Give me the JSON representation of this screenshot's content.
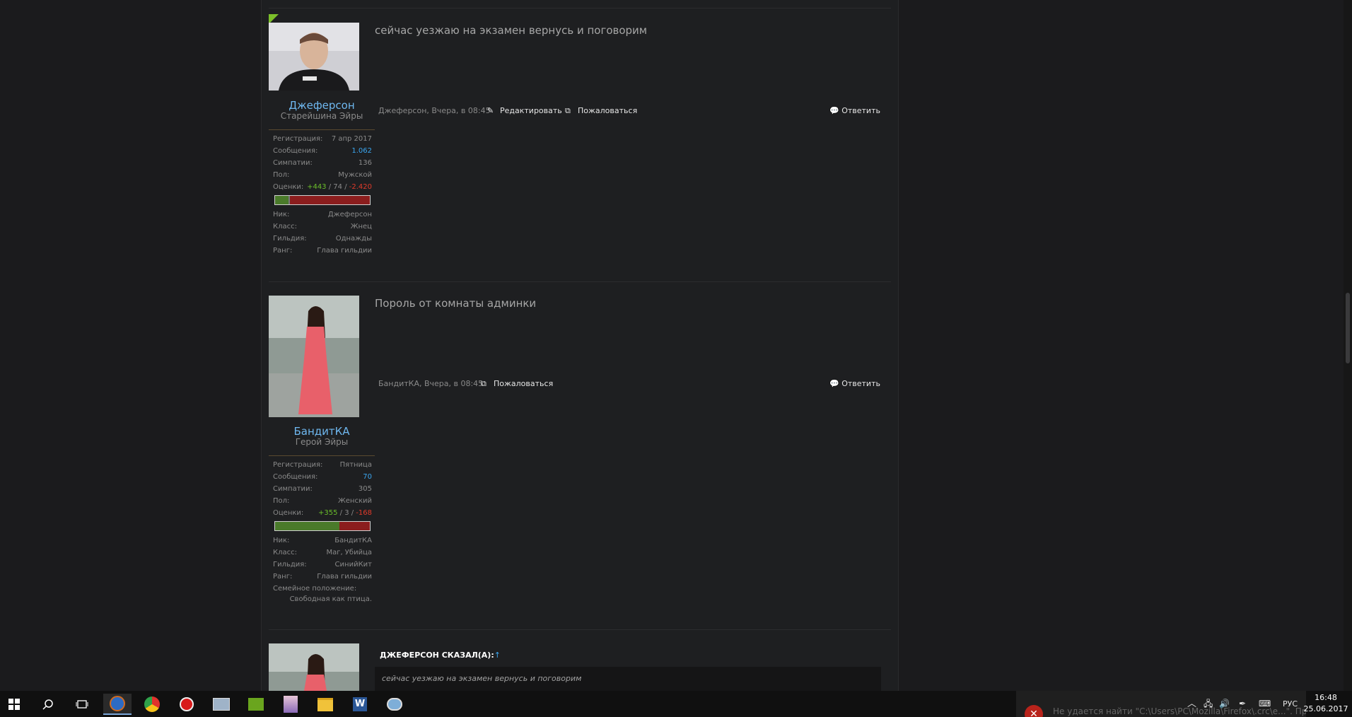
{
  "posts": [
    {
      "message": "сейчас уезжаю на экзамен вернусь и поговорим",
      "username": "Джеферсон",
      "usertitle": "Старейшина Эйры",
      "stats": [
        {
          "k": "Регистрация:",
          "v": "7 апр 2017"
        },
        {
          "k": "Сообщения:",
          "v": "1.062"
        },
        {
          "k": "Симпатии:",
          "v": "136"
        },
        {
          "k": "Пол:",
          "v": "Мужской"
        }
      ],
      "rating": {
        "label": "Оценки:",
        "pos": "+443",
        "sep1": " / ",
        "neu": "74",
        "sep2": " / ",
        "neg": "-2.420",
        "positive_fraction": 0.14,
        "neutral_fraction": 0.02
      },
      "extra": [
        {
          "k": "Ник:",
          "v": "Джеферсон"
        },
        {
          "k": "Класс:",
          "v": "Жнец"
        },
        {
          "k": "Гильдия:",
          "v": "Однажды"
        },
        {
          "k": "Ранг:",
          "v": "Глава гильдии"
        }
      ],
      "meta": "Джеферсон, Вчера, в 08:45",
      "edit_label": "Редактировать",
      "report_label": "Пожаловаться",
      "reply_label": "Ответить"
    },
    {
      "message": "Пороль от комнаты админки",
      "username": "БандитКА",
      "usertitle": "Герой Эйры",
      "stats": [
        {
          "k": "Регистрация:",
          "v": "Пятница"
        },
        {
          "k": "Сообщения:",
          "v": "70"
        },
        {
          "k": "Симпатии:",
          "v": "305"
        },
        {
          "k": "Пол:",
          "v": "Женский"
        }
      ],
      "rating": {
        "label": "Оценки:",
        "pos": "+355",
        "sep1": " / ",
        "neu": "3",
        "sep2": " / ",
        "neg": "-168",
        "positive_fraction": 0.68,
        "neutral_fraction": 0.0
      },
      "extra": [
        {
          "k": "Ник:",
          "v": "БандитКА"
        },
        {
          "k": "Класс:",
          "v": "Маг, Убийца"
        },
        {
          "k": "Гильдия:",
          "v": "СинийКит"
        },
        {
          "k": "Ранг:",
          "v": "Глава гильдии"
        }
      ],
      "family_label": "Семейное положение:",
      "family_value": "Свободная как птица.",
      "meta": "БандитКА, Вчера, в 08:45",
      "report_label": "Пожаловаться",
      "reply_label": "Ответить"
    }
  ],
  "quote": {
    "head": "ДЖЕФЕРСОН СКАЗАЛ(А):",
    "arrow": "↑",
    "text": "сейчас уезжаю на экзамен вернусь и поговорим"
  },
  "taskbar": {
    "lang": "РУС",
    "time": "16:48",
    "date": "25.06.2017",
    "notification": "Не удается найти \"C:\\Users\\PC\\Mozilla\\Firefox\\.crc\\e...\". Проверьте..."
  },
  "colors": {
    "link": "#6fb8f0",
    "positive": "#6bbf2a",
    "negative": "#e03a2a",
    "accent": "#7cbf2a"
  }
}
